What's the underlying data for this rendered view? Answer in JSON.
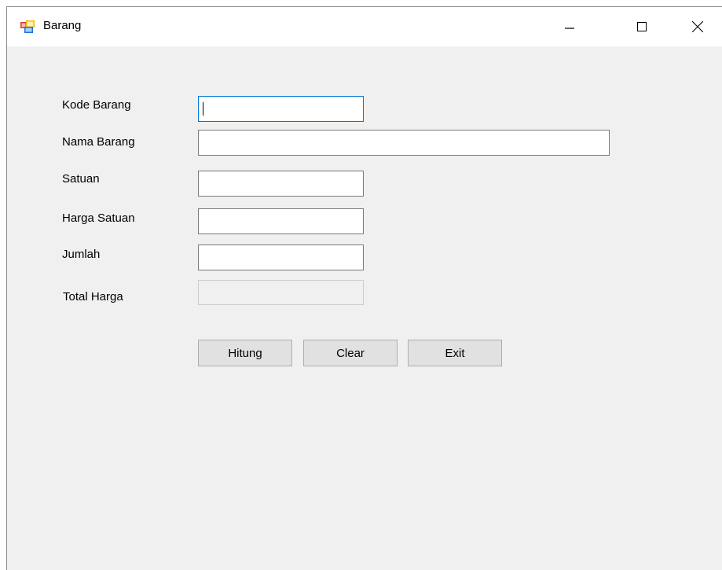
{
  "window": {
    "title": "Barang"
  },
  "titlebar": {
    "icons": [
      "app-icon",
      "minimize-icon",
      "maximize-icon",
      "close-icon"
    ]
  },
  "form": {
    "labels": {
      "kode_barang": "Kode Barang",
      "nama_barang": "Nama Barang",
      "satuan": "Satuan",
      "harga_satuan": "Harga Satuan",
      "jumlah": "Jumlah",
      "total_harga": "Total Harga"
    },
    "values": {
      "kode_barang": "",
      "nama_barang": "",
      "satuan": "",
      "harga_satuan": "",
      "jumlah": "",
      "total_harga": ""
    }
  },
  "buttons": {
    "hitung": "Hitung",
    "clear": "Clear",
    "exit": "Exit"
  },
  "colors": {
    "focus_border": "#0078d7",
    "client_bg": "#f0f0f0",
    "button_bg": "#e1e1e1"
  }
}
